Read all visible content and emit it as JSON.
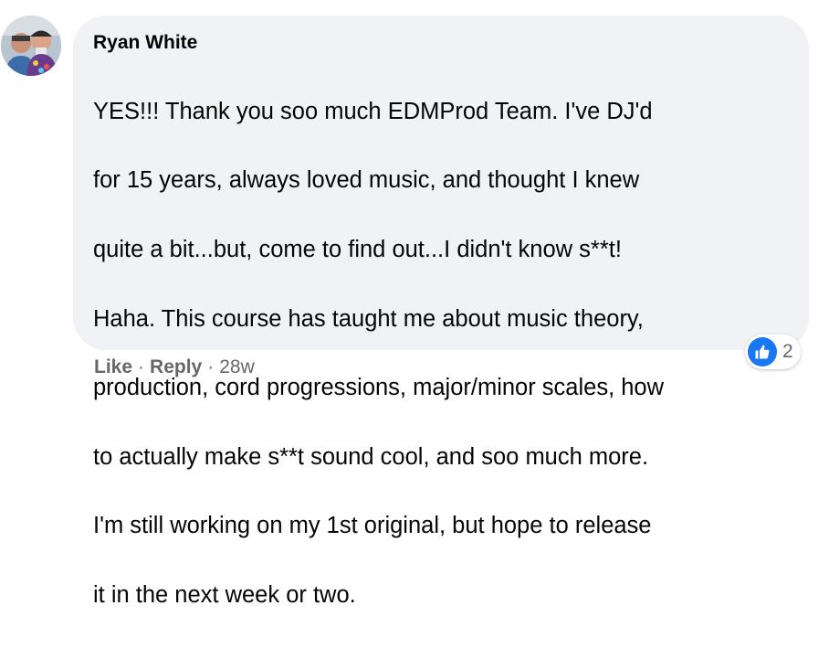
{
  "comment": {
    "author": "Ryan White",
    "text_lines": [
      "YES!!! Thank you soo much EDMProd Team. I've DJ'd",
      "for 15 years, always loved music, and thought I knew",
      "quite a bit...but, come to find out...I didn't know s**t!",
      "Haha. This course has taught me about music theory,",
      "production, cord progressions, major/minor scales, how",
      "to actually make s**t sound cool, and soo much more.",
      "I'm still working on my 1st original, but hope to release",
      "it in the next week or two."
    ],
    "reactions": {
      "icon": "like-icon",
      "count": "2"
    },
    "actions": {
      "like_label": "Like",
      "separator": "·",
      "reply_label": "Reply",
      "timestamp": "28w"
    }
  },
  "colors": {
    "bubble_bg": "#f0f2f5",
    "text": "#050505",
    "secondary_text": "#65676b",
    "like_blue": "#1877f2"
  }
}
